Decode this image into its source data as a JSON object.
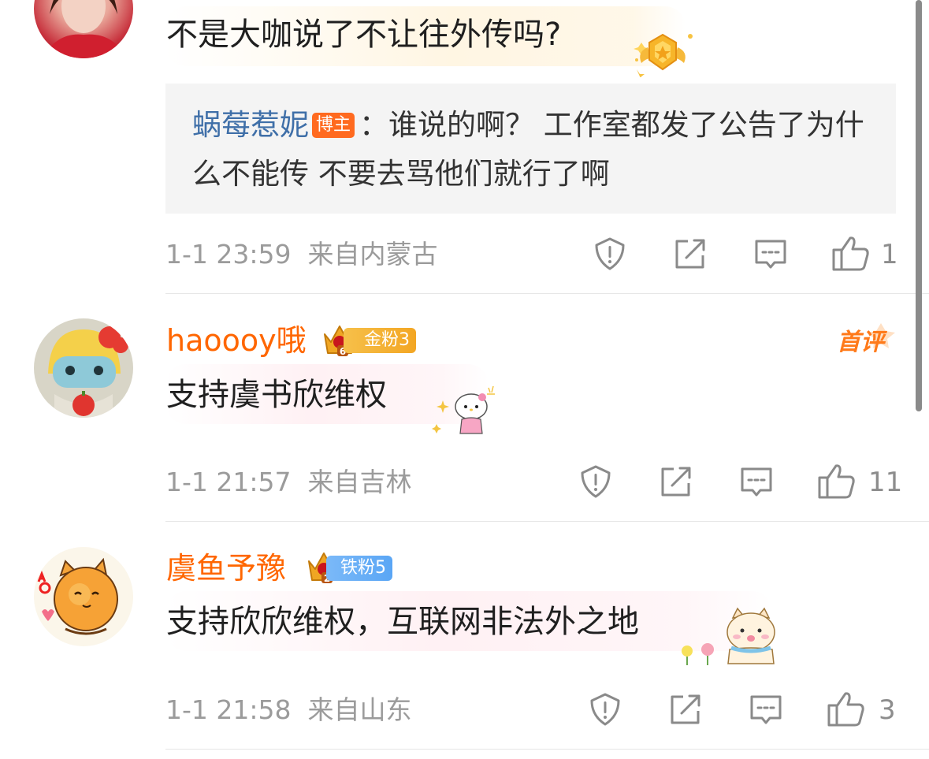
{
  "comments": [
    {
      "text": "不是大咖说了不让往外传吗?",
      "reply": {
        "author": "蜗莓惹妮",
        "badge": "博主",
        "text": "：谁说的啊？  工作室都发了公告了为什么不能传 不要去骂他们就行了啊"
      },
      "time": "1-1 23:59",
      "location": "来自内蒙古",
      "likes": "1"
    },
    {
      "author": "haoooy哦",
      "fan_badge": "金粉3",
      "fan_level": "6",
      "first_comment_label": "首评",
      "text": "支持虞书欣维权",
      "time": "1-1 21:57",
      "location": "来自吉林",
      "likes": "11"
    },
    {
      "author": "虞鱼予豫",
      "fan_badge": "铁粉5",
      "fan_level": "2",
      "text": "支持欣欣维权，互联网非法外之地",
      "time": "1-1 21:58",
      "location": "来自山东",
      "likes": "3"
    }
  ],
  "icons": {
    "report": "report-icon",
    "share": "share-icon",
    "comment": "comment-icon",
    "like": "like-icon"
  },
  "colors": {
    "name_orange": "#ff6600",
    "reply_name_blue": "#3f6fa8",
    "gold_fan": "#f3a623",
    "iron_fan": "#5aa6f5",
    "meta_gray": "#9b9b9b"
  }
}
